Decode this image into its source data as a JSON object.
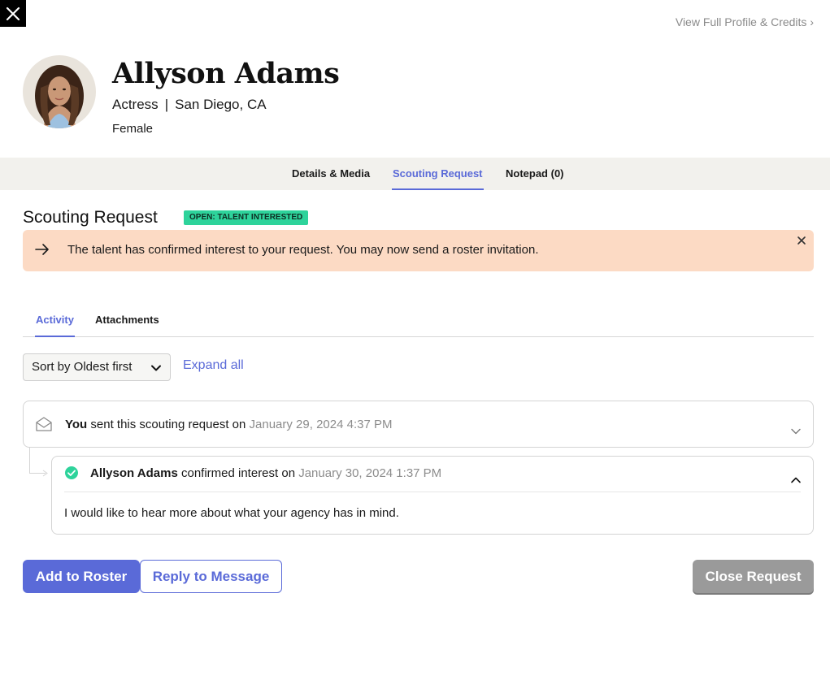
{
  "header": {
    "full_profile_link": "View Full Profile & Credits ›"
  },
  "profile": {
    "name": "Allyson Adams",
    "role": "Actress",
    "separator": "|",
    "location": "San Diego, CA",
    "gender": "Female"
  },
  "tabs": [
    {
      "label": "Details & Media",
      "active": false
    },
    {
      "label": "Scouting Request",
      "active": true
    },
    {
      "label": "Notepad (0)",
      "active": false
    }
  ],
  "request": {
    "title": "Scouting Request",
    "status": "OPEN: TALENT INTERESTED",
    "banner_message": "The talent has confirmed interest to your request. You may now send a roster invitation."
  },
  "subtabs": [
    {
      "label": "Activity",
      "active": true
    },
    {
      "label": "Attachments",
      "active": false
    }
  ],
  "controls": {
    "sort_value": "Sort by Oldest first",
    "expand_all": "Expand all"
  },
  "activity": [
    {
      "actor": "You",
      "action": " sent this scouting request on ",
      "date": "January 29, 2024 4:37 PM",
      "expanded": false
    },
    {
      "actor": "Allyson Adams",
      "action": " confirmed interest on ",
      "date": "January 30, 2024 1:37 PM",
      "message": "I would like to hear more about what your agency has in mind.",
      "expanded": true
    }
  ],
  "actions": {
    "add_to_roster": "Add to Roster",
    "reply": "Reply to Message",
    "close_request": "Close Request"
  },
  "colors": {
    "accent": "#5a6ad8",
    "badge": "#2ed39b",
    "banner": "#fcdac4",
    "close_button": "#9a9a9a"
  },
  "icons": [
    "close-icon",
    "arrow-right-icon",
    "envelope-open-icon",
    "check-circle-icon",
    "chevron-down-icon",
    "chevron-up-icon"
  ]
}
